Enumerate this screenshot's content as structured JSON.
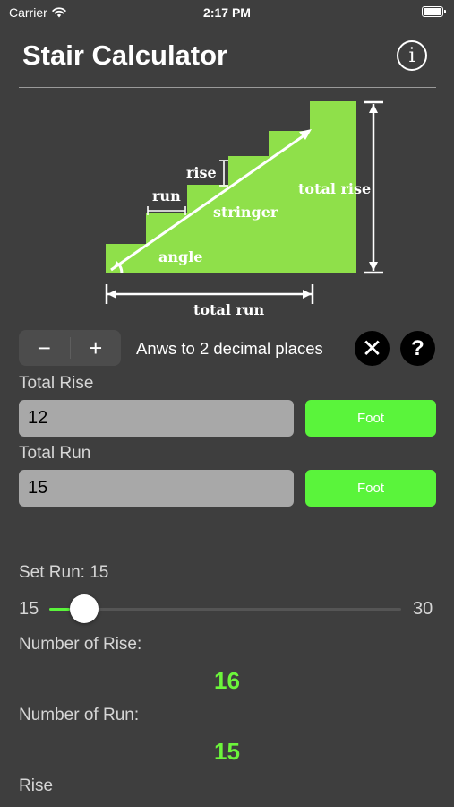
{
  "status": {
    "carrier": "Carrier",
    "time": "2:17 PM",
    "battery_level": 1.0
  },
  "header": {
    "title": "Stair Calculator",
    "info_icon": "info-icon",
    "info_glyph": "i"
  },
  "diagram": {
    "labels": {
      "rise": "rise",
      "run": "run",
      "stringer": "stringer",
      "total_rise": "total rise",
      "angle": "angle",
      "total_run": "total run"
    },
    "colors": {
      "stairs": "#8fe04a",
      "arrows": "#ffffff"
    }
  },
  "controls": {
    "decrement_label": "−",
    "increment_label": "+",
    "precision_text": "Anws to 2 decimal places",
    "clear_glyph": "✕",
    "help_glyph": "?"
  },
  "inputs": {
    "total_rise_label": "Total Rise",
    "total_rise_value": "12",
    "total_rise_unit": "Foot",
    "total_run_label": "Total Run",
    "total_run_value": "15",
    "total_run_unit": "Foot"
  },
  "slider": {
    "label": "Set Run: 15",
    "min": "15",
    "max": "30",
    "value": 15
  },
  "results": {
    "number_of_rise_label": "Number of Rise:",
    "number_of_rise_value": "16",
    "number_of_run_label": "Number of Run:",
    "number_of_run_value": "15",
    "rise_label": "Rise"
  },
  "colors": {
    "background": "#3e3e3e",
    "accent": "#5af43b",
    "result": "#6cf53b",
    "input": "#a8a8a8"
  }
}
